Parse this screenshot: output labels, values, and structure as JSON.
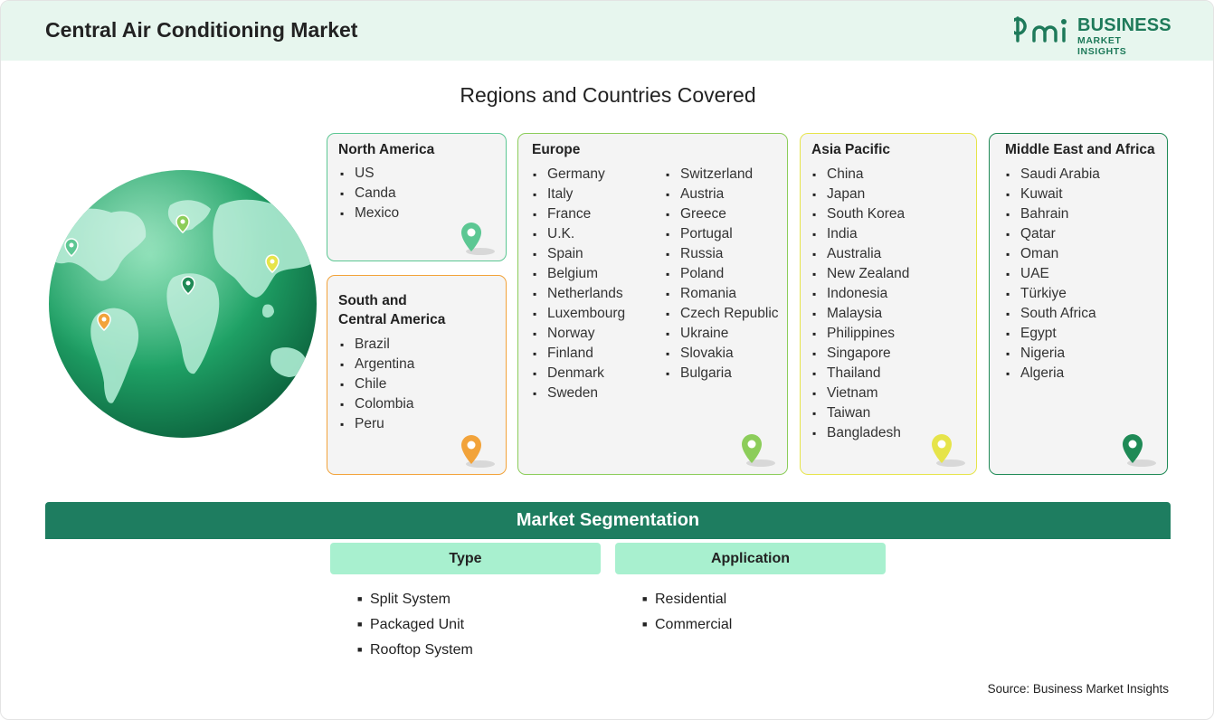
{
  "header": {
    "title": "Central Air Conditioning Market",
    "logo_line1": "BUSINESS",
    "logo_line2": "MARKET INSIGHTS"
  },
  "section_title": "Regions and Countries Covered",
  "colors": {
    "brand_green": "#1e7d60",
    "header_bg": "#e7f6ee",
    "segment_head_bg": "#a8f0cf",
    "north_america": "#5cc793",
    "south_central_america": "#f2a33a",
    "europe": "#8ccd5a",
    "asia_pacific": "#e6e44a",
    "middle_east_africa": "#1f8a56"
  },
  "regions": {
    "north_america": {
      "title": "North America",
      "countries": [
        "US",
        "Canda",
        "Mexico"
      ]
    },
    "south_central_america": {
      "title_line1": "South and",
      "title_line2": "Central America",
      "countries": [
        "Brazil",
        "Argentina",
        "Chile",
        "Colombia",
        "Peru"
      ]
    },
    "europe": {
      "title": "Europe",
      "col1": [
        "Germany",
        "Italy",
        "France",
        "U.K.",
        "Spain",
        "Belgium",
        "Netherlands",
        "Luxembourg",
        "Norway",
        "Finland",
        "Denmark",
        "Sweden"
      ],
      "col2": [
        "Switzerland",
        "Austria",
        "Greece",
        "Portugal",
        "Russia",
        "Poland",
        "Romania",
        "Czech Republic",
        "Ukraine",
        "Slovakia",
        "Bulgaria"
      ]
    },
    "asia_pacific": {
      "title": "Asia Pacific",
      "countries": [
        "China",
        "Japan",
        "South Korea",
        "India",
        "Australia",
        "New Zealand",
        "Indonesia",
        "Malaysia",
        "Philippines",
        "Singapore",
        "Thailand",
        "Vietnam",
        "Taiwan",
        "Bangladesh"
      ]
    },
    "middle_east_africa": {
      "title": "Middle East and Africa",
      "countries": [
        "Saudi Arabia",
        "Kuwait",
        "Bahrain",
        "Qatar",
        "Oman",
        "UAE",
        "Türkiye",
        "South Africa",
        "Egypt",
        "Nigeria",
        "Algeria"
      ]
    }
  },
  "segmentation": {
    "title": "Market Segmentation",
    "type": {
      "title": "Type",
      "items": [
        "Split System",
        "Packaged Unit",
        "Rooftop System"
      ]
    },
    "application": {
      "title": "Application",
      "items": [
        "Residential",
        "Commercial"
      ]
    }
  },
  "source": "Source: Business Market Insights"
}
